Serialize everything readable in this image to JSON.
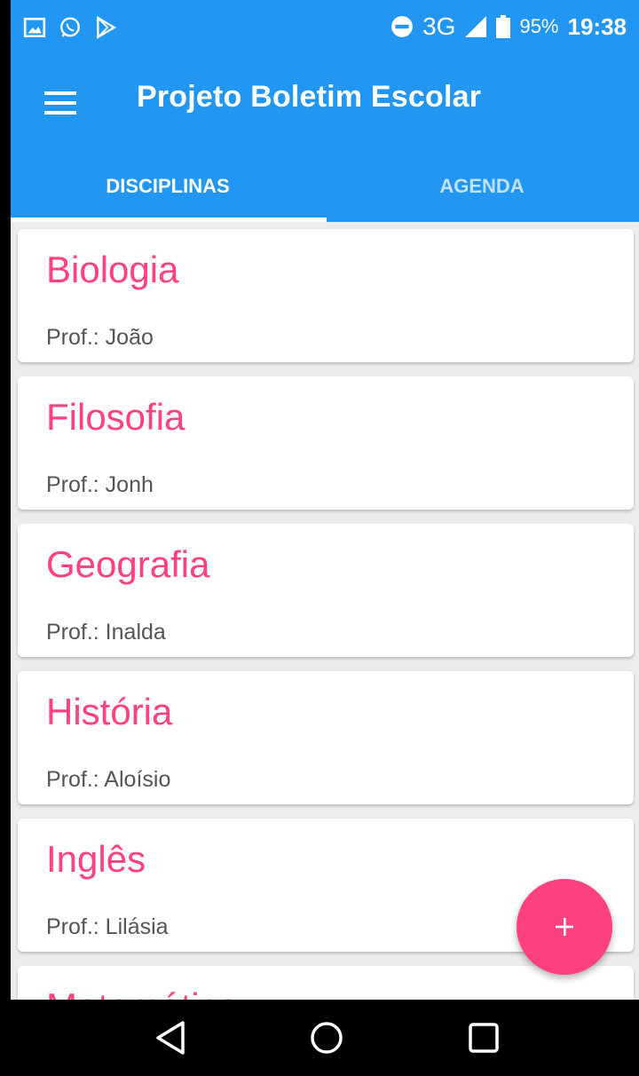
{
  "status_bar": {
    "network": "3G",
    "battery_percent": "95%",
    "time": "19:38",
    "icons": [
      "gallery-icon",
      "whatsapp-icon",
      "play-store-icon",
      "do-not-disturb-icon",
      "signal-icon",
      "battery-icon"
    ]
  },
  "app_bar": {
    "title": "Projeto Boletim Escolar",
    "menu_icon": "hamburger-menu-icon"
  },
  "tabs": [
    {
      "label": "DISCIPLINAS",
      "active": true
    },
    {
      "label": "AGENDA",
      "active": false
    }
  ],
  "subjects": [
    {
      "name": "Biologia",
      "teacher": "Prof.: João"
    },
    {
      "name": "Filosofia",
      "teacher": "Prof.: Jonh"
    },
    {
      "name": "Geografia",
      "teacher": "Prof.: Inalda"
    },
    {
      "name": "História",
      "teacher": "Prof.: Aloísio"
    },
    {
      "name": "Inglês",
      "teacher": "Prof.: Lilásia"
    },
    {
      "name": "Matemática",
      "teacher": ""
    }
  ],
  "fab": {
    "icon": "plus-icon"
  },
  "nav": {
    "back_icon": "back-icon",
    "home_icon": "home-icon",
    "recents_icon": "recents-icon"
  },
  "colors": {
    "primary": "#2196f3",
    "accent": "#ff4081",
    "background": "#ececec"
  }
}
